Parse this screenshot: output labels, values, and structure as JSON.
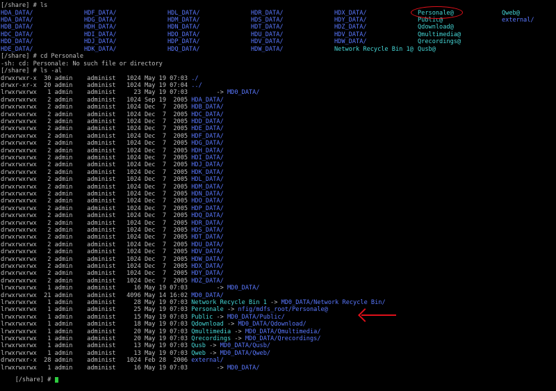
{
  "ls_prompt": "[/share] # ls",
  "ls_grid": [
    [
      "HDA_DATA/",
      "HDF_DATA/",
      "HDL_DATA/",
      "HDR_DATA/",
      "HDX_DATA/",
      "Personale@",
      "Qweb@"
    ],
    [
      "HDA_DATA/",
      "HDG_DATA/",
      "HDM_DATA/",
      "HDS_DATA/",
      "HDY_DATA/",
      "Public@",
      "external/"
    ],
    [
      "HDB_DATA/",
      "HDH_DATA/",
      "HDN_DATA/",
      "HDT_DATA/",
      "HDZ_DATA/",
      "Qdownload@",
      ""
    ],
    [
      "HDC_DATA/",
      "HDI_DATA/",
      "HDO_DATA/",
      "HDU_DATA/",
      "HDV_DATA/",
      "Qmultimedia@",
      ""
    ],
    [
      "HDD_DATA/",
      "HDJ_DATA/",
      "HDP_DATA/",
      "HDV_DATA/",
      "HDW_DATA/",
      "Qrecordings@",
      ""
    ],
    [
      "HDE_DATA/",
      "HDK_DATA/",
      "HDQ_DATA/",
      "HDW_DATA/",
      "Network Recycle Bin 1@",
      "Qusb@",
      ""
    ]
  ],
  "cd_prompt": "[/share] # cd Personale",
  "cd_error": "-sh: cd: Personale: No such file or directory",
  "lsal_prompt": "[/share] # ls -al",
  "entries": [
    {
      "perm": "drwxrwxr-x",
      "links": "30",
      "owner": "admin",
      "group": "administ",
      "size": "1024",
      "date": "May 19 07:03",
      "name": "./",
      "target": "",
      "color": "blue"
    },
    {
      "perm": "drwxr-xr-x",
      "links": "20",
      "owner": "admin",
      "group": "administ",
      "size": "1024",
      "date": "May 19 07:04",
      "name": "../",
      "target": "",
      "color": "blue"
    },
    {
      "perm": "lrwxrwxrwx",
      "links": "1",
      "owner": "admin",
      "group": "administ",
      "size": "23",
      "date": "May 19 07:03",
      "name": "",
      "target": "MD0_DATA/",
      "color": "dim"
    },
    {
      "perm": "drwxrwxrwx",
      "links": "2",
      "owner": "admin",
      "group": "administ",
      "size": "1024",
      "date": "Sep 19  2005",
      "name": "HDA_DATA/",
      "target": "",
      "color": "blue"
    },
    {
      "perm": "drwxrwxrwx",
      "links": "2",
      "owner": "admin",
      "group": "administ",
      "size": "1024",
      "date": "Dec  7  2005",
      "name": "HDB_DATA/",
      "target": "",
      "color": "blue"
    },
    {
      "perm": "drwxrwxrwx",
      "links": "2",
      "owner": "admin",
      "group": "administ",
      "size": "1024",
      "date": "Dec  7  2005",
      "name": "HDC_DATA/",
      "target": "",
      "color": "blue"
    },
    {
      "perm": "drwxrwxrwx",
      "links": "2",
      "owner": "admin",
      "group": "administ",
      "size": "1024",
      "date": "Dec  7  2005",
      "name": "HDD_DATA/",
      "target": "",
      "color": "blue"
    },
    {
      "perm": "drwxrwxrwx",
      "links": "2",
      "owner": "admin",
      "group": "administ",
      "size": "1024",
      "date": "Dec  7  2005",
      "name": "HDE_DATA/",
      "target": "",
      "color": "blue"
    },
    {
      "perm": "drwxrwxrwx",
      "links": "2",
      "owner": "admin",
      "group": "administ",
      "size": "1024",
      "date": "Dec  7  2005",
      "name": "HDF_DATA/",
      "target": "",
      "color": "blue"
    },
    {
      "perm": "drwxrwxrwx",
      "links": "2",
      "owner": "admin",
      "group": "administ",
      "size": "1024",
      "date": "Dec  7  2005",
      "name": "HDG_DATA/",
      "target": "",
      "color": "blue"
    },
    {
      "perm": "drwxrwxrwx",
      "links": "2",
      "owner": "admin",
      "group": "administ",
      "size": "1024",
      "date": "Dec  7  2005",
      "name": "HDH_DATA/",
      "target": "",
      "color": "blue"
    },
    {
      "perm": "drwxrwxrwx",
      "links": "2",
      "owner": "admin",
      "group": "administ",
      "size": "1024",
      "date": "Dec  7  2005",
      "name": "HDI_DATA/",
      "target": "",
      "color": "blue"
    },
    {
      "perm": "drwxrwxrwx",
      "links": "2",
      "owner": "admin",
      "group": "administ",
      "size": "1024",
      "date": "Dec  7  2005",
      "name": "HDJ_DATA/",
      "target": "",
      "color": "blue"
    },
    {
      "perm": "drwxrwxrwx",
      "links": "2",
      "owner": "admin",
      "group": "administ",
      "size": "1024",
      "date": "Dec  7  2005",
      "name": "HDK_DATA/",
      "target": "",
      "color": "blue"
    },
    {
      "perm": "drwxrwxrwx",
      "links": "2",
      "owner": "admin",
      "group": "administ",
      "size": "1024",
      "date": "Dec  7  2005",
      "name": "HDL_DATA/",
      "target": "",
      "color": "blue"
    },
    {
      "perm": "drwxrwxrwx",
      "links": "2",
      "owner": "admin",
      "group": "administ",
      "size": "1024",
      "date": "Dec  7  2005",
      "name": "HDM_DATA/",
      "target": "",
      "color": "blue"
    },
    {
      "perm": "drwxrwxrwx",
      "links": "2",
      "owner": "admin",
      "group": "administ",
      "size": "1024",
      "date": "Dec  7  2005",
      "name": "HDN_DATA/",
      "target": "",
      "color": "blue"
    },
    {
      "perm": "drwxrwxrwx",
      "links": "2",
      "owner": "admin",
      "group": "administ",
      "size": "1024",
      "date": "Dec  7  2005",
      "name": "HDO_DATA/",
      "target": "",
      "color": "blue"
    },
    {
      "perm": "drwxrwxrwx",
      "links": "2",
      "owner": "admin",
      "group": "administ",
      "size": "1024",
      "date": "Dec  7  2005",
      "name": "HDP_DATA/",
      "target": "",
      "color": "blue"
    },
    {
      "perm": "drwxrwxrwx",
      "links": "2",
      "owner": "admin",
      "group": "administ",
      "size": "1024",
      "date": "Dec  7  2005",
      "name": "HDQ_DATA/",
      "target": "",
      "color": "blue"
    },
    {
      "perm": "drwxrwxrwx",
      "links": "2",
      "owner": "admin",
      "group": "administ",
      "size": "1024",
      "date": "Dec  7  2005",
      "name": "HDR_DATA/",
      "target": "",
      "color": "blue"
    },
    {
      "perm": "drwxrwxrwx",
      "links": "2",
      "owner": "admin",
      "group": "administ",
      "size": "1024",
      "date": "Dec  7  2005",
      "name": "HDS_DATA/",
      "target": "",
      "color": "blue"
    },
    {
      "perm": "drwxrwxrwx",
      "links": "2",
      "owner": "admin",
      "group": "administ",
      "size": "1024",
      "date": "Dec  7  2005",
      "name": "HDT_DATA/",
      "target": "",
      "color": "blue"
    },
    {
      "perm": "drwxrwxrwx",
      "links": "2",
      "owner": "admin",
      "group": "administ",
      "size": "1024",
      "date": "Dec  7  2005",
      "name": "HDU_DATA/",
      "target": "",
      "color": "blue"
    },
    {
      "perm": "drwxrwxrwx",
      "links": "2",
      "owner": "admin",
      "group": "administ",
      "size": "1024",
      "date": "Dec  7  2005",
      "name": "HDV_DATA/",
      "target": "",
      "color": "blue"
    },
    {
      "perm": "drwxrwxrwx",
      "links": "2",
      "owner": "admin",
      "group": "administ",
      "size": "1024",
      "date": "Dec  7  2005",
      "name": "HDW_DATA/",
      "target": "",
      "color": "blue"
    },
    {
      "perm": "drwxrwxrwx",
      "links": "2",
      "owner": "admin",
      "group": "administ",
      "size": "1024",
      "date": "Dec  7  2005",
      "name": "HDX_DATA/",
      "target": "",
      "color": "blue"
    },
    {
      "perm": "drwxrwxrwx",
      "links": "2",
      "owner": "admin",
      "group": "administ",
      "size": "1024",
      "date": "Dec  7  2005",
      "name": "HDY_DATA/",
      "target": "",
      "color": "blue"
    },
    {
      "perm": "drwxrwxrwx",
      "links": "2",
      "owner": "admin",
      "group": "administ",
      "size": "1024",
      "date": "Dec  7  2005",
      "name": "HDZ_DATA/",
      "target": "",
      "color": "blue"
    },
    {
      "perm": "lrwxrwxrwx",
      "links": "1",
      "owner": "admin",
      "group": "administ",
      "size": "16",
      "date": "May 19 07:03",
      "name": "",
      "target": "MD0_DATA/",
      "color": "dim"
    },
    {
      "perm": "drwxrwxrwx",
      "links": "21",
      "owner": "admin",
      "group": "administ",
      "size": "4096",
      "date": "May 14 16:02",
      "name": "MD0_DATA/",
      "target": "",
      "color": "blue"
    },
    {
      "perm": "lrwxrwxrwx",
      "links": "1",
      "owner": "admin",
      "group": "administ",
      "size": "28",
      "date": "May 19 07:03",
      "name": "Network Recycle Bin 1",
      "target": "MD0_DATA/Network Recycle Bin/",
      "color": "cyan"
    },
    {
      "perm": "lrwxrwxrwx",
      "links": "1",
      "owner": "admin",
      "group": "administ",
      "size": "25",
      "date": "May 19 07:03",
      "name": "Personale",
      "target": "nfig/mdfs_root/Personale@",
      "color": "cyan"
    },
    {
      "perm": "lrwxrwxrwx",
      "links": "1",
      "owner": "admin",
      "group": "administ",
      "size": "15",
      "date": "May 19 07:03",
      "name": "Public",
      "target": "MD0_DATA/Public/",
      "color": "cyan"
    },
    {
      "perm": "lrwxrwxrwx",
      "links": "1",
      "owner": "admin",
      "group": "administ",
      "size": "18",
      "date": "May 19 07:03",
      "name": "Qdownload",
      "target": "MD0_DATA/Qdownload/",
      "color": "cyan"
    },
    {
      "perm": "lrwxrwxrwx",
      "links": "1",
      "owner": "admin",
      "group": "administ",
      "size": "20",
      "date": "May 19 07:03",
      "name": "Qmultimedia",
      "target": "MD0_DATA/Qmultimedia/",
      "color": "cyan"
    },
    {
      "perm": "lrwxrwxrwx",
      "links": "1",
      "owner": "admin",
      "group": "administ",
      "size": "20",
      "date": "May 19 07:03",
      "name": "Qrecordings",
      "target": "MD0_DATA/Qrecordings/",
      "color": "cyan"
    },
    {
      "perm": "lrwxrwxrwx",
      "links": "1",
      "owner": "admin",
      "group": "administ",
      "size": "13",
      "date": "May 19 07:03",
      "name": "Qusb",
      "target": "MD0_DATA/Qusb/",
      "color": "cyan"
    },
    {
      "perm": "lrwxrwxrwx",
      "links": "1",
      "owner": "admin",
      "group": "administ",
      "size": "13",
      "date": "May 19 07:03",
      "name": "Qweb",
      "target": "MD0_DATA/Qweb/",
      "color": "cyan"
    },
    {
      "perm": "drwxrwxr-x",
      "links": "28",
      "owner": "admin",
      "group": "administ",
      "size": "1024",
      "date": "Feb 28  2006",
      "name": "external/",
      "target": "",
      "color": "blue"
    },
    {
      "perm": "lrwxrwxrwx",
      "links": "1",
      "owner": "admin",
      "group": "administ",
      "size": "16",
      "date": "May 19 07:03",
      "name": "",
      "target": "MD0_DATA/",
      "color": "dim"
    }
  ],
  "final_prompt": "[/share] # ",
  "colors": {
    "directory": "#5a78ff",
    "symlink": "#46d7d7",
    "text": "#c0c0c0",
    "annotation": "#e0101a",
    "cursor": "#2ecc40"
  }
}
